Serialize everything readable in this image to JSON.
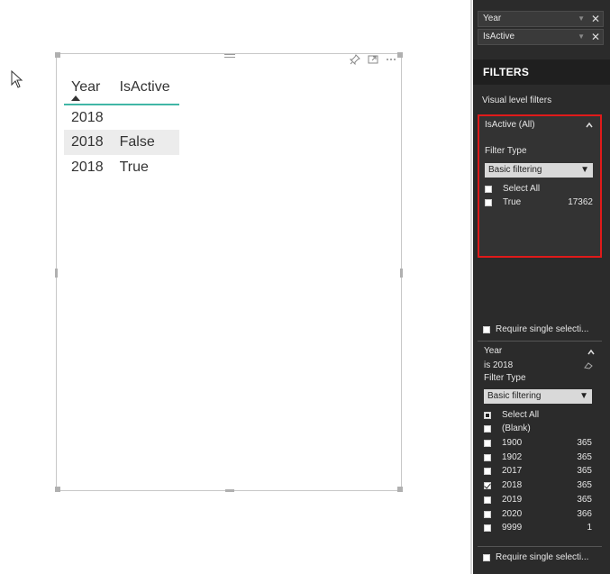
{
  "canvas": {
    "table": {
      "columns": [
        "Year",
        "IsActive"
      ],
      "rows": [
        {
          "year": "2018",
          "isactive": ""
        },
        {
          "year": "2018",
          "isactive": "False"
        },
        {
          "year": "2018",
          "isactive": "True"
        }
      ]
    }
  },
  "pane": {
    "fields": [
      {
        "label": "Year"
      },
      {
        "label": "IsActive"
      }
    ],
    "filters_title": "FILTERS",
    "visual_level_filters": "Visual level filters",
    "isactive_card": {
      "title": "IsActive (All)",
      "filter_type_label": "Filter Type",
      "filter_type_value": "Basic filtering",
      "options": [
        {
          "label": "Select All",
          "count": "",
          "checked": false
        },
        {
          "label": "True",
          "count": "17362",
          "checked": false
        }
      ],
      "require_single": "Require single selecti..."
    },
    "year_card": {
      "title": "Year",
      "condition": "is 2018",
      "filter_type_label": "Filter Type",
      "filter_type_value": "Basic filtering",
      "options": [
        {
          "label": "Select All",
          "count": "",
          "state": "partial"
        },
        {
          "label": "(Blank)",
          "count": "",
          "state": "none"
        },
        {
          "label": "1900",
          "count": "365",
          "state": "none"
        },
        {
          "label": "1902",
          "count": "365",
          "state": "none"
        },
        {
          "label": "2017",
          "count": "365",
          "state": "none"
        },
        {
          "label": "2018",
          "count": "365",
          "state": "checked"
        },
        {
          "label": "2019",
          "count": "365",
          "state": "none"
        },
        {
          "label": "2020",
          "count": "366",
          "state": "none"
        },
        {
          "label": "9999",
          "count": "1",
          "state": "none"
        }
      ],
      "require_single": "Require single selecti..."
    }
  },
  "colors": {
    "accent_teal": "#41b6a6",
    "highlight_red": "#e01a1a",
    "pane_bg": "#2b2b2b"
  }
}
